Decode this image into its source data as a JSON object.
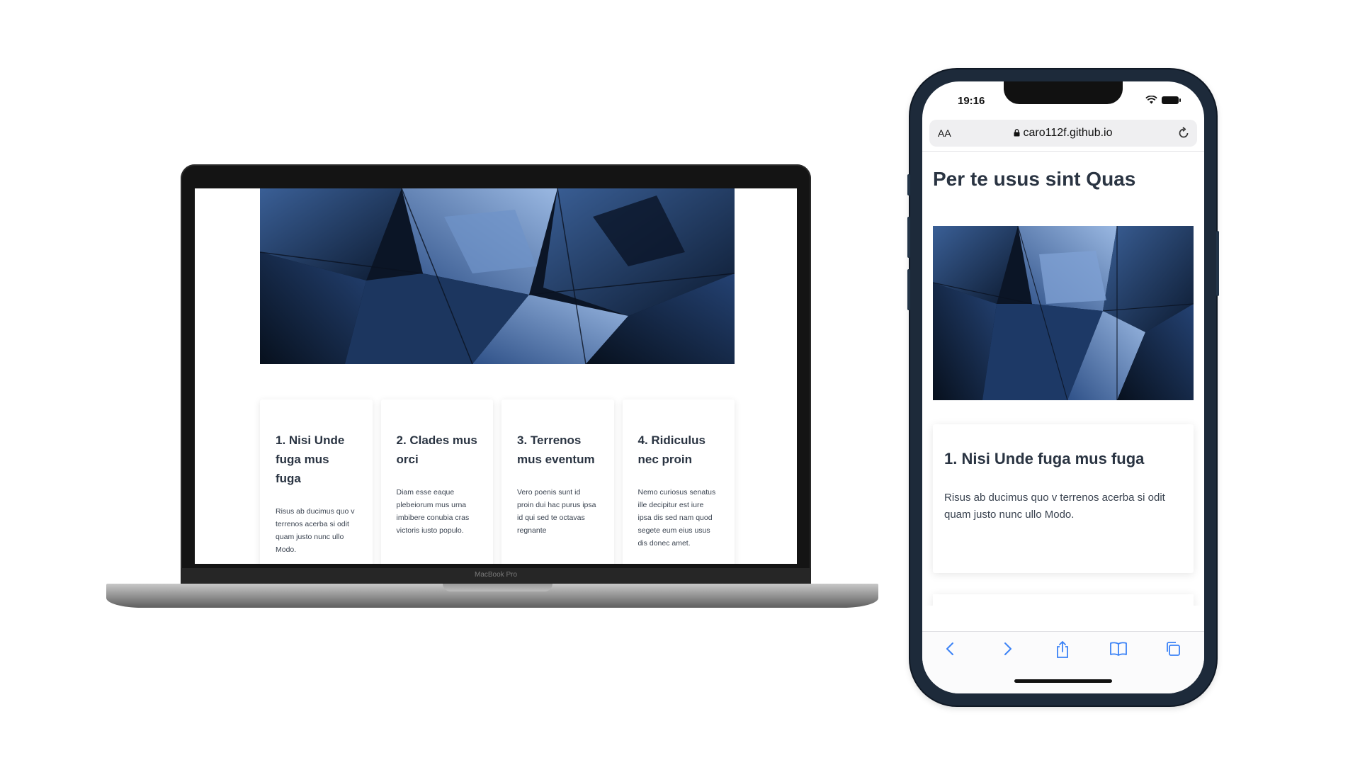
{
  "laptop": {
    "brand_label": "MacBook Pro",
    "cards": [
      {
        "title": "1. Nisi Unde fuga mus fuga",
        "body": "Risus ab ducimus quo v terrenos acerba si odit quam justo nunc ullo Modo."
      },
      {
        "title": "2. Clades mus orci",
        "body": "Diam esse eaque plebeiorum mus urna imbibere conubia cras victoris iusto populo."
      },
      {
        "title": "3. Terrenos mus eventum",
        "body": "Vero poenis sunt id proin dui hac purus ipsa id qui sed te octavas regnante"
      },
      {
        "title": "4. Ridiculus nec proin",
        "body": "Nemo curiosus senatus ille decipitur est iure ipsa dis sed nam quod segete eum eius usus dis donec amet."
      }
    ]
  },
  "phone": {
    "status_time": "19:16",
    "url_aa": "AA",
    "url": "caro112f.github.io",
    "page_title": "Per te usus sint Quas",
    "card": {
      "title": "1. Nisi Unde fuga mus fuga",
      "body": "Risus ab ducimus quo v terrenos acerba si odit quam justo nunc ullo Modo."
    },
    "toolbar_icons": [
      "back-icon",
      "forward-icon",
      "share-icon",
      "bookmarks-icon",
      "tabs-icon"
    ]
  },
  "colors": {
    "hero_dark": "#0b1526",
    "hero_mid": "#2b4c7e",
    "hero_light": "#8fb0dd",
    "safari_blue": "#3b82f6",
    "phone_frame": "#1d2a3a"
  }
}
